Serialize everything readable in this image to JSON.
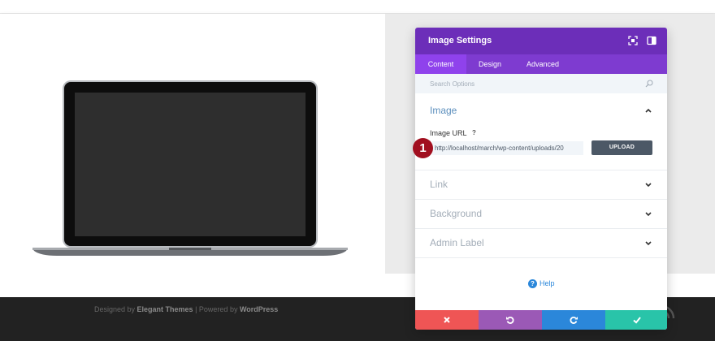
{
  "panel": {
    "title": "Image Settings",
    "tabs": [
      {
        "label": "Content",
        "active": true
      },
      {
        "label": "Design",
        "active": false
      },
      {
        "label": "Advanced",
        "active": false
      }
    ],
    "search_placeholder": "Search Options",
    "sections": [
      {
        "title": "Image",
        "open": true
      },
      {
        "title": "Link",
        "open": false
      },
      {
        "title": "Background",
        "open": false
      },
      {
        "title": "Admin Label",
        "open": false
      }
    ],
    "image_url": {
      "label": "Image URL",
      "help": "?",
      "value": "http://localhost/march/wp-content/uploads/20"
    },
    "upload_label": "UPLOAD",
    "help_link": "Help",
    "actions": [
      {
        "name": "discard",
        "color": "#ef5555"
      },
      {
        "name": "undo",
        "color": "#9b59b6"
      },
      {
        "name": "redo",
        "color": "#2b87da"
      },
      {
        "name": "save",
        "color": "#29c4a9"
      }
    ]
  },
  "marker": "1",
  "footer": {
    "designed_by": "Designed by ",
    "theme_link": "Elegant Themes",
    "separator": " | Powered by ",
    "wp_link": "WordPress"
  },
  "colors": {
    "header": "#6c2eb9",
    "tabs": "#7e3bd0",
    "active_tab": "#8f42ec",
    "footer_bg": "#222222",
    "marker": "#a10f1f"
  }
}
